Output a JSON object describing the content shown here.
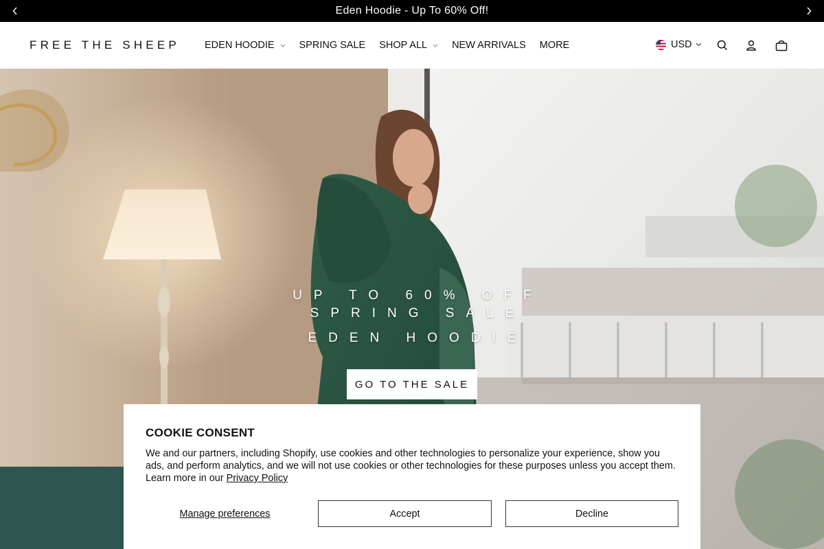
{
  "announcement": {
    "text": "Eden Hoodie - Up To 60% Off!",
    "prev_icon": "chevron-left-icon",
    "next_icon": "chevron-right-icon"
  },
  "header": {
    "logo": "FREE THE SHEEP",
    "nav": [
      {
        "label": "EDEN HOODIE",
        "has_dropdown": true
      },
      {
        "label": "SPRING SALE",
        "has_dropdown": false
      },
      {
        "label": "SHOP ALL",
        "has_dropdown": true
      },
      {
        "label": "NEW ARRIVALS",
        "has_dropdown": false
      },
      {
        "label": "MORE",
        "has_dropdown": false
      }
    ],
    "currency": "USD",
    "currency_flag": "us-flag-icon",
    "icons": [
      "search-icon",
      "account-icon",
      "cart-icon"
    ]
  },
  "hero": {
    "line1": "UP TO 60% OFF",
    "line2": "SPRING SALE",
    "line3": "EDEN HOODIE",
    "cta": "GO TO THE SALE"
  },
  "cookie": {
    "title": "COOKIE CONSENT",
    "body": "We and our partners, including Shopify, use cookies and other technologies to personalize your experience, show you ads, and perform analytics, and we will not use cookies or other technologies for these purposes unless you accept them. Learn more in our ",
    "link": "Privacy Policy",
    "manage": "Manage preferences",
    "accept": "Accept",
    "decline": "Decline"
  },
  "colors": {
    "announcement_bg": "#000000",
    "hoodie_green": "#2d5a45",
    "text": "#111111"
  }
}
